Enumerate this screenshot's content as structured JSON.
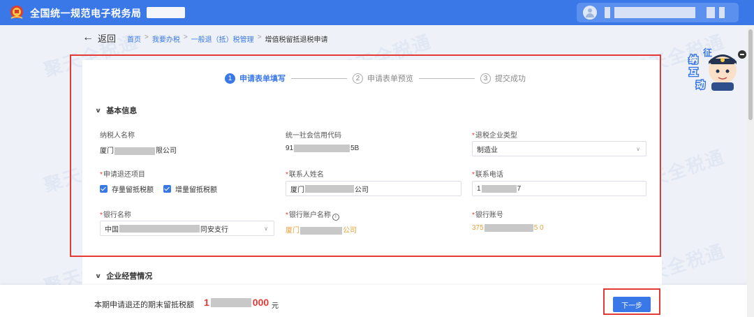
{
  "header": {
    "app_title": "全国统一规范电子税务局",
    "user_name_redacted": true
  },
  "breadcrumb": {
    "back_label": "返回",
    "items": [
      "首页",
      "我要办税",
      "一般退（抵）税管理",
      "增值税留抵退税申请"
    ],
    "separator": ">"
  },
  "steps": [
    {
      "num": "1",
      "label": "申请表单填写",
      "state": "active"
    },
    {
      "num": "2",
      "label": "申请表单预览",
      "state": "todo"
    },
    {
      "num": "3",
      "label": "提交成功",
      "state": "todo"
    }
  ],
  "sections": {
    "basic": "基本信息",
    "business": "企业经营情况"
  },
  "fields": {
    "taxpayer_name": {
      "label": "纳税人名称",
      "value_prefix": "厦门",
      "value_suffix": "限公司"
    },
    "credit_code": {
      "label": "统一社会信用代码",
      "value_prefix": "91",
      "value_suffix": "5B"
    },
    "refund_type": {
      "label": "退税企业类型",
      "value": "制造业"
    },
    "refund_items": {
      "label": "申请退还项目",
      "options": [
        "存量留抵税额",
        "增量留抵税额"
      ]
    },
    "contact_name": {
      "label": "联系人姓名",
      "value_prefix": "厦门",
      "value_suffix": "公司"
    },
    "contact_phone": {
      "label": "联系电话",
      "value_prefix": "1",
      "value_suffix": "7"
    },
    "bank_name": {
      "label": "银行名称",
      "value_prefix": "中国",
      "value_suffix": "同安支行"
    },
    "account_name": {
      "label": "银行账户名称",
      "value_prefix": "厦门",
      "value_suffix": "公司"
    },
    "account_no": {
      "label": "银行账号",
      "value_prefix": "375",
      "value_suffix": "5 0"
    }
  },
  "footer": {
    "label": "本期申请退还的期末留抵税额",
    "amount_prefix": "1",
    "amount_suffix": "000",
    "unit": "元",
    "next_label": "下一步"
  },
  "mascot": {
    "chars": [
      "征",
      "纳",
      "互",
      "动"
    ]
  },
  "watermark_text": "聚天全税通",
  "colors": {
    "primary": "#3a78e8",
    "highlight_frame": "#e53935",
    "amount": "#e53935",
    "account_text": "#e6a23c"
  }
}
